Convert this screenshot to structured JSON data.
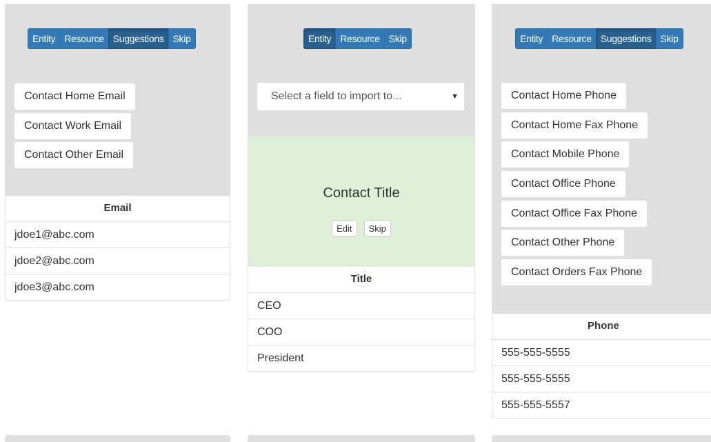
{
  "cards": [
    {
      "toolbar": {
        "entity": "Entity",
        "resource": "Resource",
        "suggestions": "Suggestions",
        "skip": "Skip"
      },
      "suggestions": [
        "Contact Home Email",
        "Contact Work Email",
        "Contact Other Email"
      ],
      "column_header": "Email",
      "rows": [
        "jdoe1@abc.com",
        "jdoe2@abc.com",
        "jdoe3@abc.com"
      ]
    },
    {
      "toolbar": {
        "entity": "Entity",
        "resource": "Resource",
        "skip": "Skip"
      },
      "select": {
        "placeholder": "Select a field to import to..."
      },
      "matched": {
        "title": "Contact Title",
        "edit": "Edit",
        "skip": "Skip"
      },
      "column_header": "Title",
      "rows": [
        "CEO",
        "COO",
        "President"
      ]
    },
    {
      "toolbar": {
        "entity": "Entity",
        "resource": "Resource",
        "suggestions": "Suggestions",
        "skip": "Skip"
      },
      "suggestions": [
        "Contact Home Phone",
        "Contact Home Fax Phone",
        "Contact Mobile Phone",
        "Contact Office Phone",
        "Contact Office Fax Phone",
        "Contact Other Phone",
        "Contact Orders Fax Phone"
      ],
      "column_header": "Phone",
      "rows": [
        "555-555-5555",
        "555-555-5555",
        "555-555-5557"
      ]
    }
  ],
  "colors": {
    "primary": "#337ab7",
    "active": "#286090",
    "matched_bg": "#dff0d8",
    "panel_bg": "#dfdfdf"
  }
}
